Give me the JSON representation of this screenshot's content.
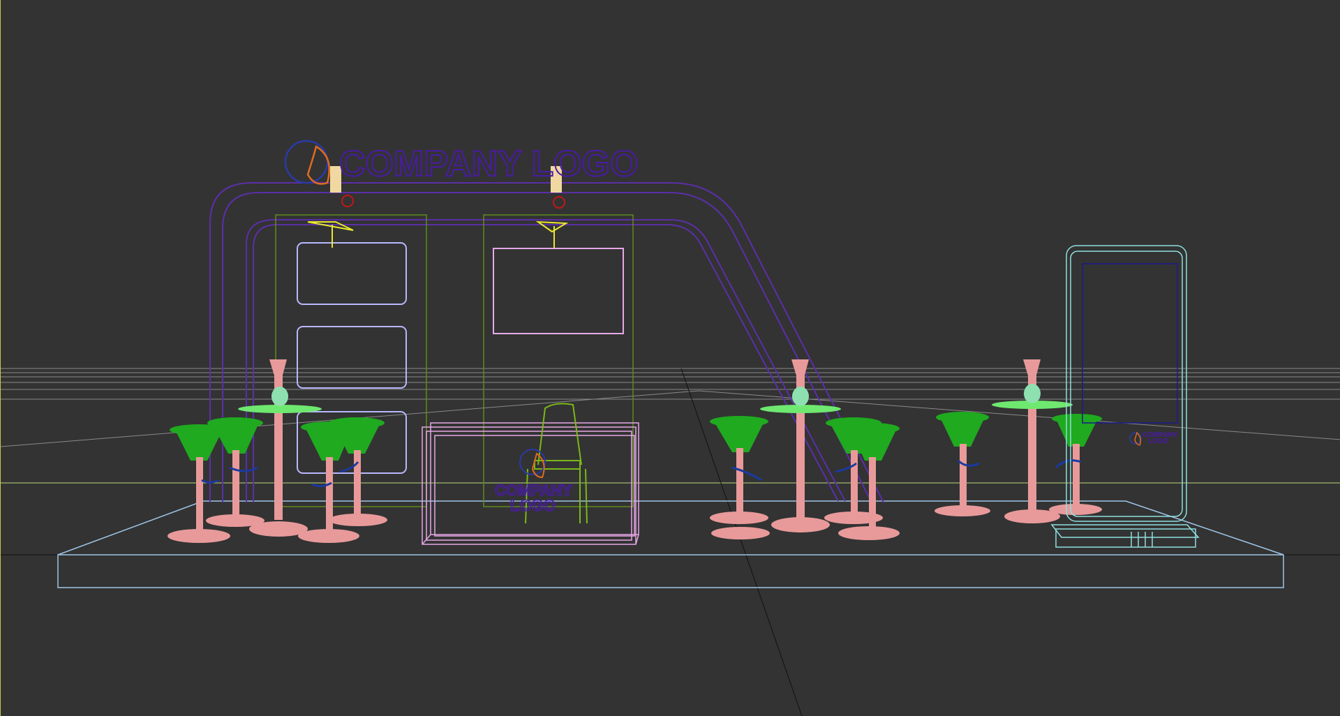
{
  "viewport": {
    "background": "#333333",
    "mode": "wireframe"
  },
  "scene": {
    "header_logo_text": "COMPANY LOGO",
    "counter_logo_line1": "COMPANY",
    "counter_logo_line2": "LOGO",
    "kiosk_logo_line1": "COMPANY",
    "kiosk_logo_line2": "LOGO"
  },
  "colors": {
    "grid": "#8a8a8a",
    "floor": "#9fc6e8",
    "frame": "#5b2fa8",
    "panel": "#5f8a1c",
    "poster": "#b8b8ff",
    "counter": "#e8a8e8",
    "table": "#e89a9a",
    "table_top": "#6fe86f",
    "stool_seat": "#1faa1f",
    "footrest": "#1a3aa0",
    "lamp": "#f0d8a0",
    "spot": "#e8e830",
    "kiosk": "#8fe0e0",
    "logo_text": "#4a1aa8",
    "logo_orange": "#e06a20"
  }
}
